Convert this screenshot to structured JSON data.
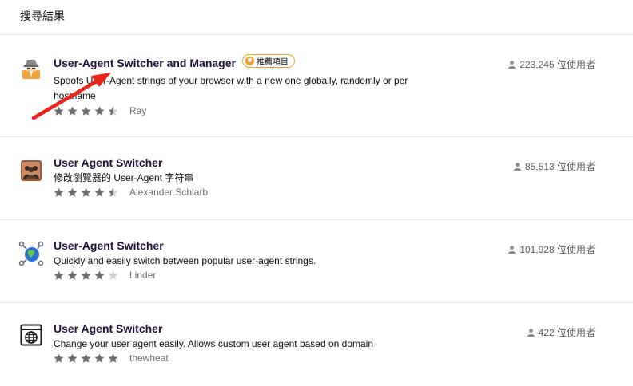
{
  "header": {
    "title": "搜尋結果"
  },
  "results": [
    {
      "name": "User-Agent Switcher and Manager",
      "badge": "推薦項目",
      "summary": "Spoofs User-Agent strings of your browser with a new one globally, randomly or per hostname",
      "rating": 4.5,
      "author": "Ray",
      "users": "223,245 位使用者",
      "icon": "spy-icon"
    },
    {
      "name": "User Agent Switcher",
      "summary": "修改瀏覽器的 User-Agent 字符串",
      "rating": 4.5,
      "author": "Alexander Schlarb",
      "users": "85,513 位使用者",
      "icon": "people-icon"
    },
    {
      "name": "User-Agent Switcher",
      "summary": "Quickly and easily switch between popular user-agent strings.",
      "rating": 4,
      "author": "Linder",
      "users": "101,928 位使用者",
      "icon": "globe-network-icon"
    },
    {
      "name": "User Agent Switcher",
      "summary": "Change your user agent easily. Allows custom user agent based on domain",
      "rating": 5,
      "author": "thewheat",
      "users": "422 位使用者",
      "icon": "browser-globe-icon"
    }
  ],
  "colors": {
    "star": "#6d6d6e",
    "star_empty": "#cfcfd8",
    "badge": "#f2a02f",
    "annotation_arrow": "#e8261c"
  }
}
